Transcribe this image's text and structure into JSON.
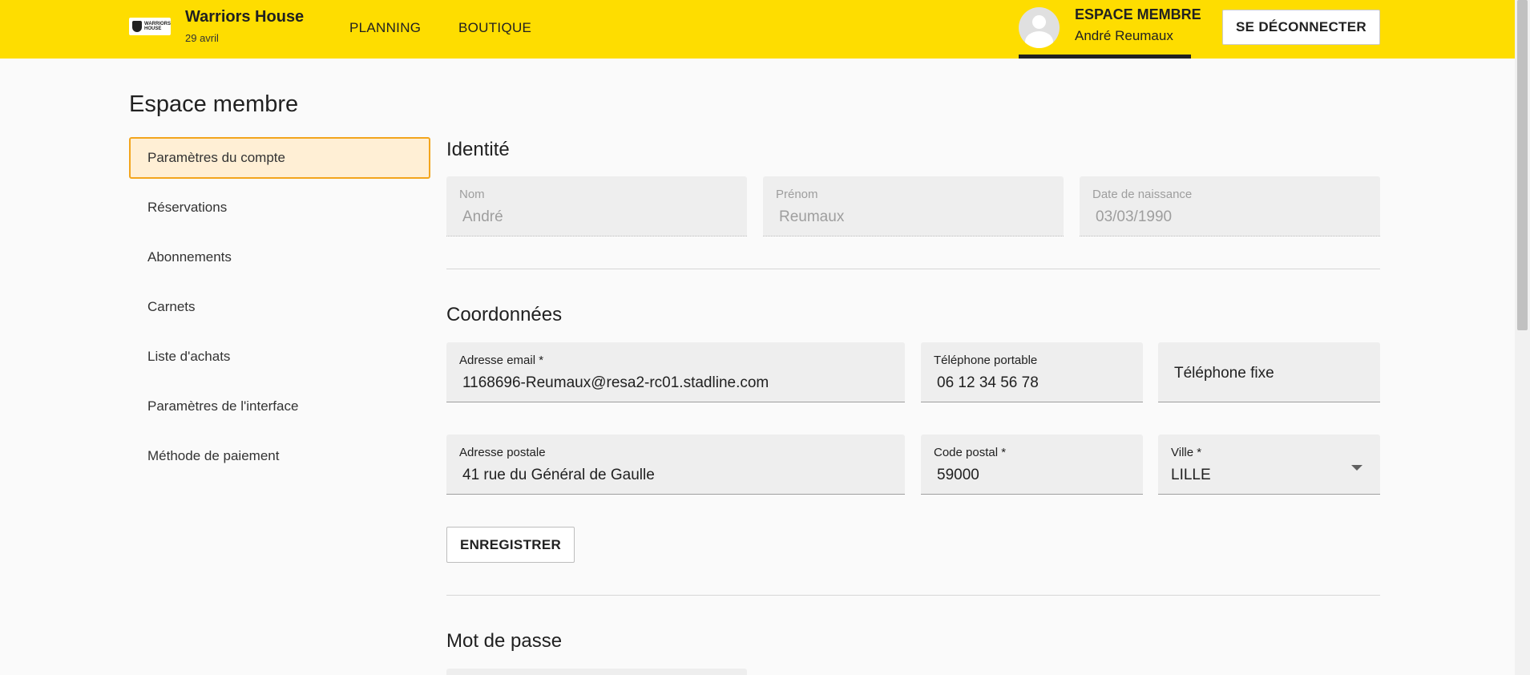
{
  "header": {
    "brand_name": "Warriors House",
    "brand_date": "29 avril",
    "logo_text_line1": "WARRIORS",
    "logo_text_line2": "HOUSE",
    "nav": [
      {
        "label": "PLANNING"
      },
      {
        "label": "BOUTIQUE"
      }
    ],
    "member_title": "ESPACE MEMBRE",
    "member_name": "André Reumaux",
    "logout_label": "SE DÉCONNECTER",
    "bg_color": "#fedd00"
  },
  "page": {
    "title": "Espace membre"
  },
  "sidebar": {
    "items": [
      {
        "label": "Paramètres du compte",
        "active": true
      },
      {
        "label": "Réservations"
      },
      {
        "label": "Abonnements"
      },
      {
        "label": "Carnets"
      },
      {
        "label": "Liste d'achats"
      },
      {
        "label": "Paramètres de l'interface"
      },
      {
        "label": "Méthode de paiement"
      }
    ],
    "active_bg": "#ffefd5",
    "active_border": "#f3a51d"
  },
  "identity": {
    "title": "Identité",
    "nom": {
      "label": "Nom",
      "value": "André"
    },
    "prenom": {
      "label": "Prénom",
      "value": "Reumaux"
    },
    "naissance": {
      "label": "Date de naissance",
      "value": "03/03/1990"
    }
  },
  "contact": {
    "title": "Coordonnées",
    "email": {
      "label": "Adresse email *",
      "value": "1168696-Reumaux@resa2-rc01.stadline.com"
    },
    "mobile": {
      "label": "Téléphone portable",
      "value": "06 12 34 56 78"
    },
    "fixe": {
      "placeholder": "Téléphone fixe"
    },
    "adresse": {
      "label": "Adresse postale",
      "value": "41 rue du Général de Gaulle"
    },
    "cp": {
      "label": "Code postal *",
      "value": "59000"
    },
    "ville": {
      "label": "Ville *",
      "value": "LILLE"
    },
    "save_label": "ENREGISTRER"
  },
  "password": {
    "title": "Mot de passe"
  }
}
